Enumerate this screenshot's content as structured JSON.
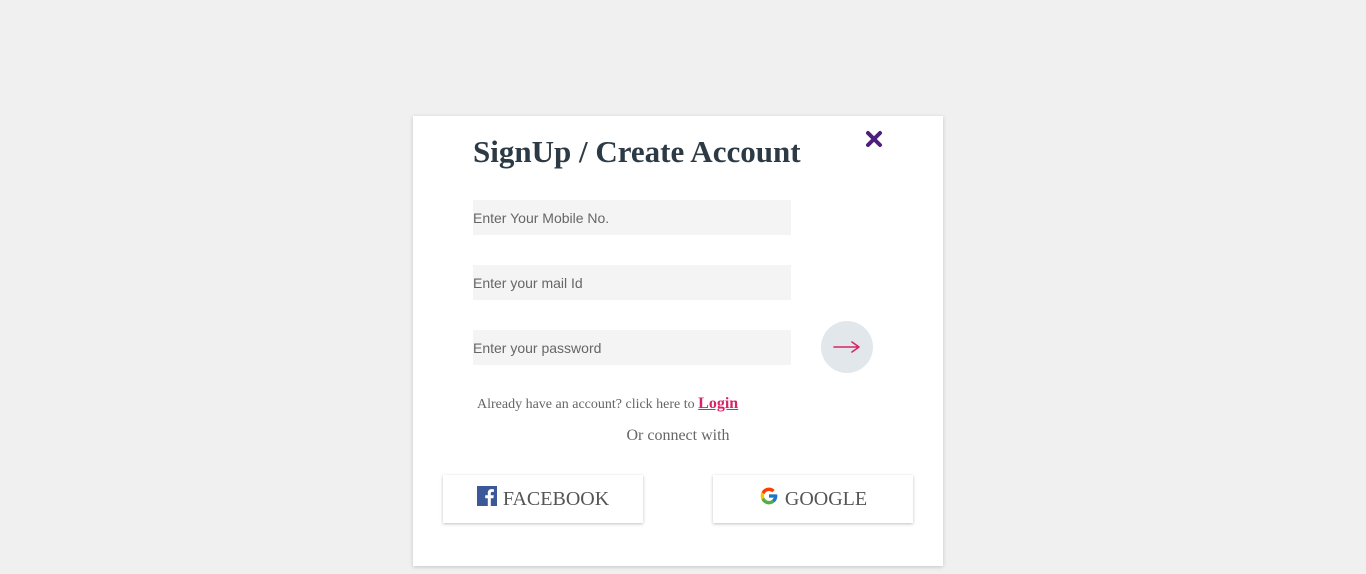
{
  "signup": {
    "title": "SignUp / Create Account",
    "mobile_placeholder": "Enter Your Mobile No.",
    "mail_placeholder": "Enter your mail Id",
    "password_placeholder": "Enter your password",
    "submit_arrow": "→",
    "already_text": "Already have an account? click here to ",
    "login_link": "Login",
    "or_connect": "Or connect with",
    "facebook_label": "FACEBOOK",
    "google_label": "GOOGLE"
  },
  "colors": {
    "background": "#f0f0f0",
    "title": "#2b3a45",
    "close": "#4b1f7a",
    "accent": "#d6256b",
    "field_bg": "#f4f4f4",
    "submit_bg": "#e2e7eb",
    "facebook": "#3b5998"
  },
  "icons": {
    "close": "close-icon",
    "submit": "arrow-right-icon",
    "facebook": "facebook-icon",
    "google": "google-icon"
  }
}
